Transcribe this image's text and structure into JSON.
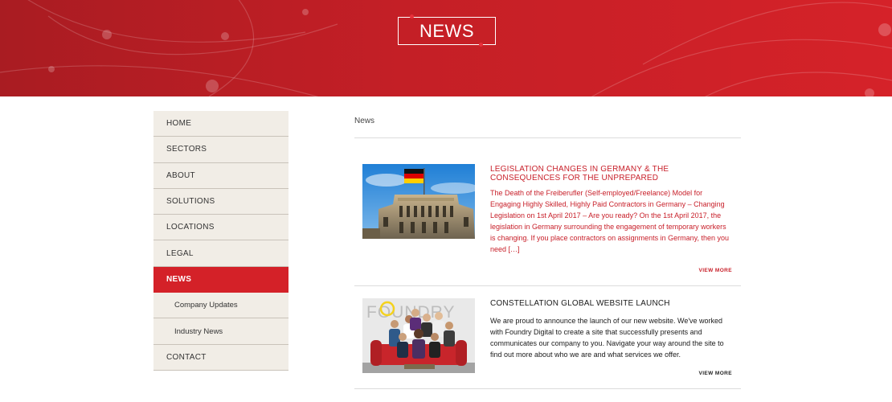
{
  "hero": {
    "title": "NEWS"
  },
  "sidebar": {
    "items": [
      {
        "label": "HOME"
      },
      {
        "label": "SECTORS"
      },
      {
        "label": "ABOUT"
      },
      {
        "label": "SOLUTIONS"
      },
      {
        "label": "LOCATIONS"
      },
      {
        "label": "LEGAL"
      },
      {
        "label": "NEWS",
        "active": true
      },
      {
        "label": "Company Updates",
        "sub": true
      },
      {
        "label": "Industry News",
        "sub": true
      },
      {
        "label": "CONTACT"
      }
    ]
  },
  "breadcrumb": "News",
  "articles": [
    {
      "title": "LEGISLATION CHANGES IN GERMANY & THE CONSEQUENCES FOR THE UNPREPARED",
      "excerpt": "The Death of the Freiberufler (Self-employed/Freelance) Model for Engaging Highly Skilled, Highly Paid Contractors in Germany – Changing Legislation on 1st April 2017 – Are you ready? On the 1st April 2017, the legislation in Germany surrounding the engagement of temporary workers is changing.  If you place contractors on assignments in Germany, then you need […]",
      "view_more": "VIEW MORE"
    },
    {
      "title": "CONSTELLATION GLOBAL WEBSITE LAUNCH",
      "excerpt": "We are proud to announce the launch of our new website. We've worked with Foundry Digital to create a site that successfully presents and communicates our company to you. Navigate your way around the site to find out more about who we are and what services we offer.",
      "view_more": "VIEW MORE",
      "image_text": "FOUNDRY"
    }
  ],
  "colors": {
    "brand_red": "#d42128",
    "nav_bg": "#f1ede6"
  }
}
